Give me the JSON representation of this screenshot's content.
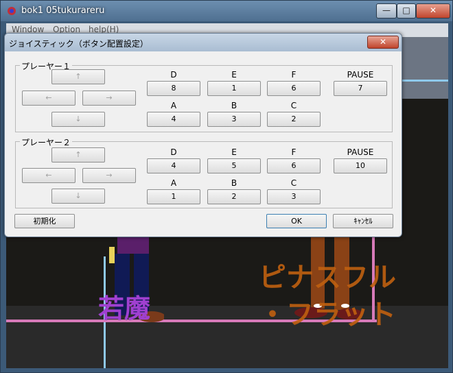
{
  "main_window": {
    "title": "bok1 05tukurareru",
    "buttons": {
      "minimize": "—",
      "maximize": "□",
      "close": "✕"
    }
  },
  "menu": {
    "items": [
      "Window",
      "Option",
      "help(H)"
    ]
  },
  "dialog": {
    "title": "ジョイスティック（ボタン配置設定）",
    "close": "✕",
    "players": [
      {
        "label": "プレーヤー１",
        "arrows": {
          "up": "↑",
          "left": "←",
          "right": "→",
          "down": "↓"
        },
        "row1_labels": [
          "D",
          "E",
          "F",
          "PAUSE"
        ],
        "row1_values": [
          "8",
          "1",
          "6",
          "7"
        ],
        "row2_labels": [
          "A",
          "B",
          "C"
        ],
        "row2_values": [
          "4",
          "3",
          "2"
        ]
      },
      {
        "label": "プレーヤー２",
        "arrows": {
          "up": "↑",
          "left": "←",
          "right": "→",
          "down": "↓"
        },
        "row1_labels": [
          "D",
          "E",
          "F",
          "PAUSE"
        ],
        "row1_values": [
          "4",
          "5",
          "6",
          "10"
        ],
        "row2_labels": [
          "A",
          "B",
          "C"
        ],
        "row2_values": [
          "1",
          "2",
          "3"
        ]
      }
    ],
    "reset_button": "初期化",
    "ok_button": "OK",
    "cancel_button": "ｷｬﾝｾﾙ"
  },
  "scene": {
    "name_left": "若魔",
    "name_right_line1": "ピナスフル",
    "name_right_line2": "・フラット",
    "colors": {
      "name_left": "#a040d0",
      "name_right": "#c06010"
    }
  }
}
